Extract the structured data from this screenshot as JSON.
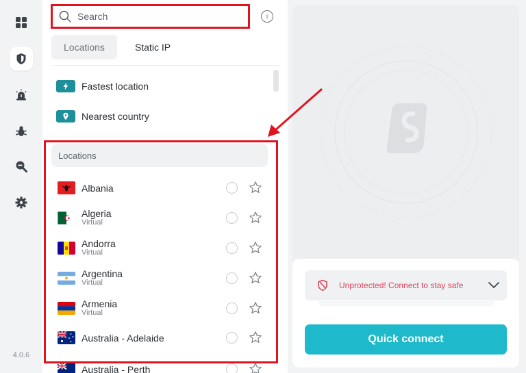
{
  "app": {
    "version": "4.0.6"
  },
  "rail": {
    "items": [
      {
        "icon": "grid-icon",
        "label": "dashboard"
      },
      {
        "icon": "shield-icon",
        "label": "vpn",
        "active": true
      },
      {
        "icon": "alert-icon",
        "label": "alerts"
      },
      {
        "icon": "bug-icon",
        "label": "antivirus"
      },
      {
        "icon": "search-zoom-icon",
        "label": "search"
      },
      {
        "icon": "gear-icon",
        "label": "settings"
      }
    ]
  },
  "search": {
    "placeholder": "Search",
    "value": ""
  },
  "tabs": [
    {
      "label": "Locations",
      "active": true
    },
    {
      "label": "Static IP",
      "active": false
    }
  ],
  "quick_options": [
    {
      "label": "Fastest location",
      "icon": "bolt-icon"
    },
    {
      "label": "Nearest country",
      "icon": "location-pin-icon"
    }
  ],
  "locations": {
    "header": "Locations",
    "items": [
      {
        "name": "Albania",
        "sub": "",
        "flag": "albania"
      },
      {
        "name": "Algeria",
        "sub": "Virtual",
        "flag": "algeria"
      },
      {
        "name": "Andorra",
        "sub": "Virtual",
        "flag": "andorra"
      },
      {
        "name": "Argentina",
        "sub": "Virtual",
        "flag": "argentina"
      },
      {
        "name": "Armenia",
        "sub": "Virtual",
        "flag": "armenia"
      },
      {
        "name": "Australia - Adelaide",
        "sub": "",
        "flag": "australia"
      },
      {
        "name": "Australia - Perth",
        "sub": "",
        "flag": "australia"
      }
    ]
  },
  "connection": {
    "status_text": "Unprotected! Connect to stay safe",
    "status_color": "#e0445c",
    "button_label": "Quick connect",
    "button_color": "#1fb9cc"
  },
  "colors": {
    "annotation": "#e0141e",
    "accent": "#1c8f9a"
  }
}
